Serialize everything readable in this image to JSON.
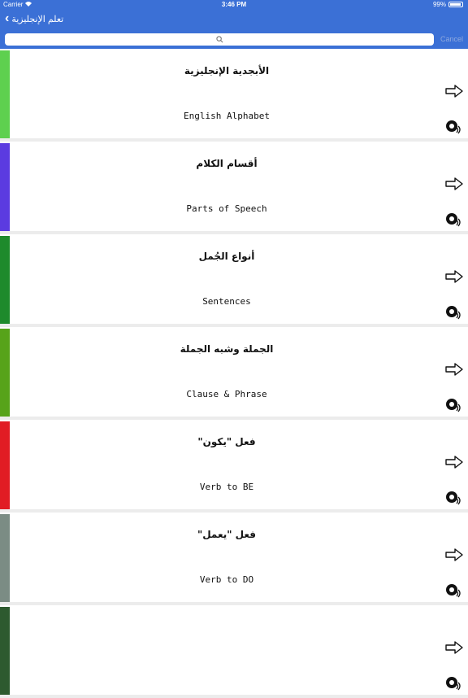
{
  "status_bar": {
    "carrier": "Carrier",
    "time": "3:46 PM",
    "battery": "99%"
  },
  "nav": {
    "back_title": "تعلم الإنجليزية"
  },
  "search": {
    "placeholder": "",
    "cancel": "Cancel"
  },
  "items": [
    {
      "ar": "الأبجدية الإنجليزية",
      "en": "English Alphabet",
      "color": "#5ed04f"
    },
    {
      "ar": "أقسام الكلام",
      "en": "Parts of Speech",
      "color": "#5b3be0"
    },
    {
      "ar": "أنواع الجُمل",
      "en": "Sentences",
      "color": "#1e8a2c"
    },
    {
      "ar": "الجملة وشبه الجملة",
      "en": "Clause & Phrase",
      "color": "#57a31a"
    },
    {
      "ar": "فعل \"يكون\"",
      "en": "Verb to BE",
      "color": "#e11c24"
    },
    {
      "ar": "فعل \"يعمل\"",
      "en": "Verb to DO",
      "color": "#7b8c84"
    },
    {
      "ar": "",
      "en": "",
      "color": "#2d5a2f"
    }
  ]
}
